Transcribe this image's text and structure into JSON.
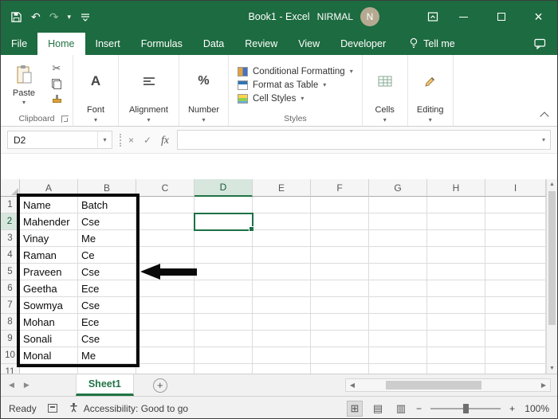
{
  "window": {
    "title": "Book1 - Excel",
    "user": "NIRMAL",
    "avatar_initial": "N"
  },
  "tabs": {
    "items": [
      "File",
      "Home",
      "Insert",
      "Formulas",
      "Data",
      "Review",
      "View",
      "Developer"
    ],
    "active": "Home",
    "tell_me": "Tell me"
  },
  "ribbon": {
    "clipboard": {
      "paste_label": "Paste",
      "group_label": "Clipboard"
    },
    "font": {
      "group_label": "Font"
    },
    "alignment": {
      "group_label": "Alignment"
    },
    "number": {
      "group_label": "Number"
    },
    "styles": {
      "items": [
        "Conditional Formatting",
        "Format as Table",
        "Cell Styles"
      ],
      "group_label": "Styles"
    },
    "cells": {
      "group_label": "Cells"
    },
    "editing": {
      "group_label": "Editing"
    }
  },
  "formula_bar": {
    "name_box": "D2",
    "fx_label": "fx",
    "value": ""
  },
  "sheet": {
    "columns": [
      "A",
      "B",
      "C",
      "D",
      "E",
      "F",
      "G",
      "H",
      "I"
    ],
    "row_numbers": [
      1,
      2,
      3,
      4,
      5,
      6,
      7,
      8,
      9,
      10,
      11
    ],
    "data": [
      [
        "Name",
        "Batch"
      ],
      [
        "Mahender",
        "Cse"
      ],
      [
        "Vinay",
        "Me"
      ],
      [
        "Raman",
        "Ce"
      ],
      [
        "Praveen",
        "Cse"
      ],
      [
        "Geetha",
        "Ece"
      ],
      [
        "Sowmya",
        "Cse"
      ],
      [
        "Mohan",
        "Ece"
      ],
      [
        "Sonali",
        "Cse"
      ],
      [
        "Monal",
        "Me"
      ]
    ],
    "selected_cell": "D2",
    "selected_column": "D",
    "selected_row": 2
  },
  "sheet_tabs": {
    "active_tab": "Sheet1"
  },
  "status_bar": {
    "mode": "Ready",
    "accessibility": "Accessibility: Good to go",
    "zoom_level": "100%"
  },
  "icons": {
    "undo": "↶",
    "redo": "↷",
    "dropdown": "▾",
    "cut": "✂",
    "percent": "%",
    "font_letter": "A",
    "close": "×",
    "cancel": "×",
    "enter": "✓",
    "nav_left": "◀",
    "nav_right": "▶",
    "scroll_up": "▲",
    "scroll_down": "▼",
    "scroll_left": "◀",
    "scroll_right": "▶",
    "plus": "+",
    "minus": "−",
    "add_sheet": "+",
    "view_normal": "⊞",
    "view_page_layout": "▤",
    "view_page_break": "▥"
  },
  "colors": {
    "title_green": "#1d6b40",
    "brand_green": "#217346",
    "selection_green": "#1b7145",
    "annotation_black": "#0a0a0a"
  }
}
